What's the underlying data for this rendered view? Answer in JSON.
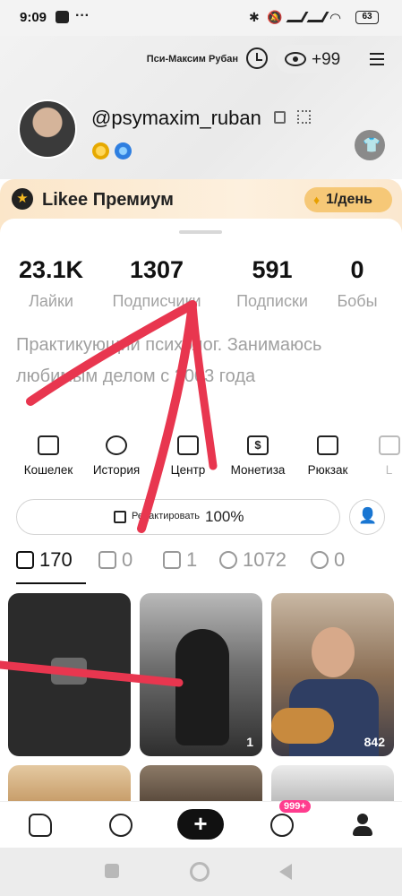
{
  "status": {
    "time": "9:09",
    "dots": "···",
    "battery": "63"
  },
  "header": {
    "display_name": "Пси-Максим Рубан",
    "views_count": "+99",
    "handle": "@psymaxim_ruban"
  },
  "premium": {
    "title": "Likee Премиум",
    "price": "1/день"
  },
  "stats": [
    {
      "value": "23.1K",
      "label": "Лайки"
    },
    {
      "value": "1307",
      "label": "Подписчики"
    },
    {
      "value": "591",
      "label": "Подписки"
    },
    {
      "value": "0",
      "label": "Бобы"
    }
  ],
  "bio": "Практикующий психолог. Занимаюсь любимым делом с 2003 года",
  "tools": [
    {
      "label": "Кошелек",
      "icon": "wallet-icon"
    },
    {
      "label": "История",
      "icon": "history-icon"
    },
    {
      "label": "Центр",
      "icon": "chart-icon"
    },
    {
      "label": "Монетиза",
      "icon": "dollar-icon"
    },
    {
      "label": "Рюкзак",
      "icon": "backpack-icon"
    },
    {
      "label": "L",
      "icon": "more-icon"
    }
  ],
  "edit": {
    "label": "Редактировать",
    "percent": "100%"
  },
  "content_tabs": [
    {
      "value": "170",
      "icon": "play-icon"
    },
    {
      "value": "0",
      "icon": "repost-icon"
    },
    {
      "value": "1",
      "icon": "bookmark-icon"
    },
    {
      "value": "1072",
      "icon": "heart-icon"
    },
    {
      "value": "0",
      "icon": "group-icon"
    }
  ],
  "videos": [
    {
      "count": "",
      "kind": "placeholder"
    },
    {
      "count": "1",
      "kind": "rider"
    },
    {
      "count": "842",
      "kind": "guitarist"
    }
  ],
  "nav": {
    "badge": "999+"
  },
  "colors": {
    "accent_pink": "#ff3c8e",
    "annotation_red": "#e8364f",
    "premium_gold": "#f6c877"
  }
}
